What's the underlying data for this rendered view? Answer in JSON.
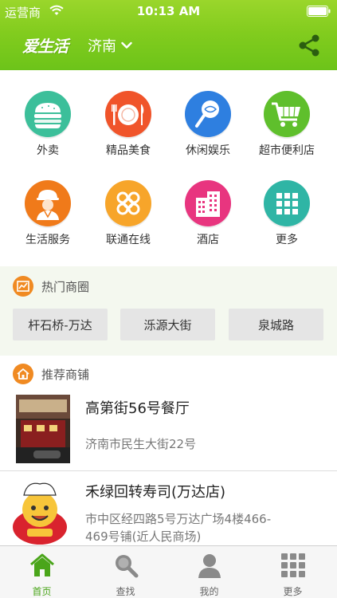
{
  "status_bar": {
    "carrier": "运营商",
    "time": "10:13 AM"
  },
  "nav": {
    "logo": "爱生活",
    "city": "济南"
  },
  "categories": [
    {
      "label": "外卖",
      "icon": "burger-icon",
      "color": "#3cbf9a"
    },
    {
      "label": "精品美食",
      "icon": "plate-utensils-icon",
      "color": "#f0542a"
    },
    {
      "label": "休闲娱乐",
      "icon": "lollipop-icon",
      "color": "#2e7fe0"
    },
    {
      "label": "超市便利店",
      "icon": "shopping-cart-icon",
      "color": "#5fbf2c"
    },
    {
      "label": "生活服务",
      "icon": "worker-icon",
      "color": "#f07a1a"
    },
    {
      "label": "联通在线",
      "icon": "unicom-knot-icon",
      "color": "#f7a52a"
    },
    {
      "label": "酒店",
      "icon": "hotel-building-icon",
      "color": "#e8357f"
    },
    {
      "label": "更多",
      "icon": "grid-icon",
      "color": "#2fb5a5"
    }
  ],
  "hot": {
    "title": "热门商圈",
    "chips": [
      "杆石桥-万达",
      "泺源大街",
      "泉城路"
    ]
  },
  "recommend": {
    "title": "推荐商铺",
    "shops": [
      {
        "name": "高第街56号餐厅",
        "address": "济南市民生大街22号"
      },
      {
        "name": "禾绿回转寿司(万达店)",
        "address": "市中区经四路5号万达广场4楼466-469号铺(近人民商场)"
      }
    ]
  },
  "tabs": [
    {
      "label": "首页",
      "icon": "home-icon"
    },
    {
      "label": "查找",
      "icon": "search-icon"
    },
    {
      "label": "我的",
      "icon": "user-icon"
    },
    {
      "label": "更多",
      "icon": "grid-icon"
    }
  ],
  "colors": {
    "brand_green": "#6bc319",
    "active_tab": "#4aa51a",
    "section_orange": "#f08a22"
  }
}
